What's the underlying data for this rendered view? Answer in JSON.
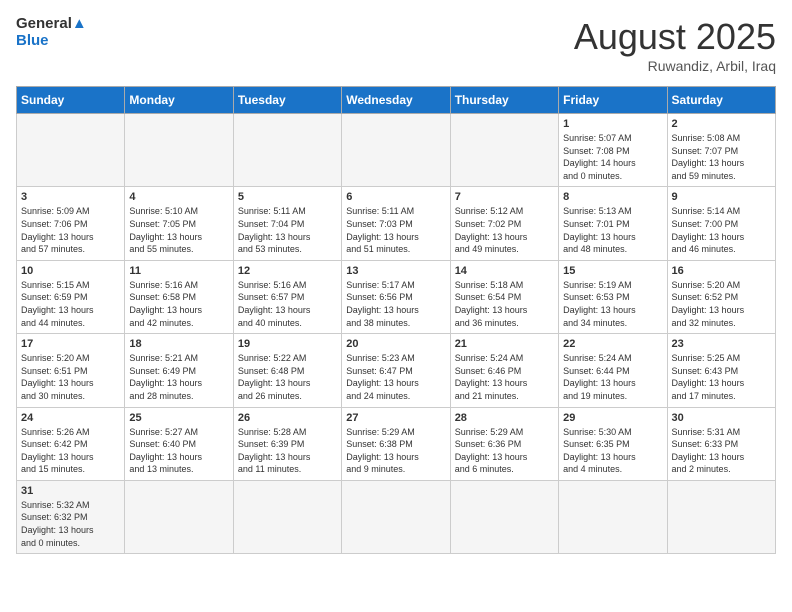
{
  "logo": {
    "general": "General",
    "blue": "Blue"
  },
  "title": "August 2025",
  "subtitle": "Ruwandiz, Arbil, Iraq",
  "days_of_week": [
    "Sunday",
    "Monday",
    "Tuesday",
    "Wednesday",
    "Thursday",
    "Friday",
    "Saturday"
  ],
  "weeks": [
    [
      {
        "day": "",
        "info": ""
      },
      {
        "day": "",
        "info": ""
      },
      {
        "day": "",
        "info": ""
      },
      {
        "day": "",
        "info": ""
      },
      {
        "day": "",
        "info": ""
      },
      {
        "day": "1",
        "info": "Sunrise: 5:07 AM\nSunset: 7:08 PM\nDaylight: 14 hours\nand 0 minutes."
      },
      {
        "day": "2",
        "info": "Sunrise: 5:08 AM\nSunset: 7:07 PM\nDaylight: 13 hours\nand 59 minutes."
      }
    ],
    [
      {
        "day": "3",
        "info": "Sunrise: 5:09 AM\nSunset: 7:06 PM\nDaylight: 13 hours\nand 57 minutes."
      },
      {
        "day": "4",
        "info": "Sunrise: 5:10 AM\nSunset: 7:05 PM\nDaylight: 13 hours\nand 55 minutes."
      },
      {
        "day": "5",
        "info": "Sunrise: 5:11 AM\nSunset: 7:04 PM\nDaylight: 13 hours\nand 53 minutes."
      },
      {
        "day": "6",
        "info": "Sunrise: 5:11 AM\nSunset: 7:03 PM\nDaylight: 13 hours\nand 51 minutes."
      },
      {
        "day": "7",
        "info": "Sunrise: 5:12 AM\nSunset: 7:02 PM\nDaylight: 13 hours\nand 49 minutes."
      },
      {
        "day": "8",
        "info": "Sunrise: 5:13 AM\nSunset: 7:01 PM\nDaylight: 13 hours\nand 48 minutes."
      },
      {
        "day": "9",
        "info": "Sunrise: 5:14 AM\nSunset: 7:00 PM\nDaylight: 13 hours\nand 46 minutes."
      }
    ],
    [
      {
        "day": "10",
        "info": "Sunrise: 5:15 AM\nSunset: 6:59 PM\nDaylight: 13 hours\nand 44 minutes."
      },
      {
        "day": "11",
        "info": "Sunrise: 5:16 AM\nSunset: 6:58 PM\nDaylight: 13 hours\nand 42 minutes."
      },
      {
        "day": "12",
        "info": "Sunrise: 5:16 AM\nSunset: 6:57 PM\nDaylight: 13 hours\nand 40 minutes."
      },
      {
        "day": "13",
        "info": "Sunrise: 5:17 AM\nSunset: 6:56 PM\nDaylight: 13 hours\nand 38 minutes."
      },
      {
        "day": "14",
        "info": "Sunrise: 5:18 AM\nSunset: 6:54 PM\nDaylight: 13 hours\nand 36 minutes."
      },
      {
        "day": "15",
        "info": "Sunrise: 5:19 AM\nSunset: 6:53 PM\nDaylight: 13 hours\nand 34 minutes."
      },
      {
        "day": "16",
        "info": "Sunrise: 5:20 AM\nSunset: 6:52 PM\nDaylight: 13 hours\nand 32 minutes."
      }
    ],
    [
      {
        "day": "17",
        "info": "Sunrise: 5:20 AM\nSunset: 6:51 PM\nDaylight: 13 hours\nand 30 minutes."
      },
      {
        "day": "18",
        "info": "Sunrise: 5:21 AM\nSunset: 6:49 PM\nDaylight: 13 hours\nand 28 minutes."
      },
      {
        "day": "19",
        "info": "Sunrise: 5:22 AM\nSunset: 6:48 PM\nDaylight: 13 hours\nand 26 minutes."
      },
      {
        "day": "20",
        "info": "Sunrise: 5:23 AM\nSunset: 6:47 PM\nDaylight: 13 hours\nand 24 minutes."
      },
      {
        "day": "21",
        "info": "Sunrise: 5:24 AM\nSunset: 6:46 PM\nDaylight: 13 hours\nand 21 minutes."
      },
      {
        "day": "22",
        "info": "Sunrise: 5:24 AM\nSunset: 6:44 PM\nDaylight: 13 hours\nand 19 minutes."
      },
      {
        "day": "23",
        "info": "Sunrise: 5:25 AM\nSunset: 6:43 PM\nDaylight: 13 hours\nand 17 minutes."
      }
    ],
    [
      {
        "day": "24",
        "info": "Sunrise: 5:26 AM\nSunset: 6:42 PM\nDaylight: 13 hours\nand 15 minutes."
      },
      {
        "day": "25",
        "info": "Sunrise: 5:27 AM\nSunset: 6:40 PM\nDaylight: 13 hours\nand 13 minutes."
      },
      {
        "day": "26",
        "info": "Sunrise: 5:28 AM\nSunset: 6:39 PM\nDaylight: 13 hours\nand 11 minutes."
      },
      {
        "day": "27",
        "info": "Sunrise: 5:29 AM\nSunset: 6:38 PM\nDaylight: 13 hours\nand 9 minutes."
      },
      {
        "day": "28",
        "info": "Sunrise: 5:29 AM\nSunset: 6:36 PM\nDaylight: 13 hours\nand 6 minutes."
      },
      {
        "day": "29",
        "info": "Sunrise: 5:30 AM\nSunset: 6:35 PM\nDaylight: 13 hours\nand 4 minutes."
      },
      {
        "day": "30",
        "info": "Sunrise: 5:31 AM\nSunset: 6:33 PM\nDaylight: 13 hours\nand 2 minutes."
      }
    ],
    [
      {
        "day": "31",
        "info": "Sunrise: 5:32 AM\nSunset: 6:32 PM\nDaylight: 13 hours\nand 0 minutes."
      },
      {
        "day": "",
        "info": ""
      },
      {
        "day": "",
        "info": ""
      },
      {
        "day": "",
        "info": ""
      },
      {
        "day": "",
        "info": ""
      },
      {
        "day": "",
        "info": ""
      },
      {
        "day": "",
        "info": ""
      }
    ]
  ]
}
